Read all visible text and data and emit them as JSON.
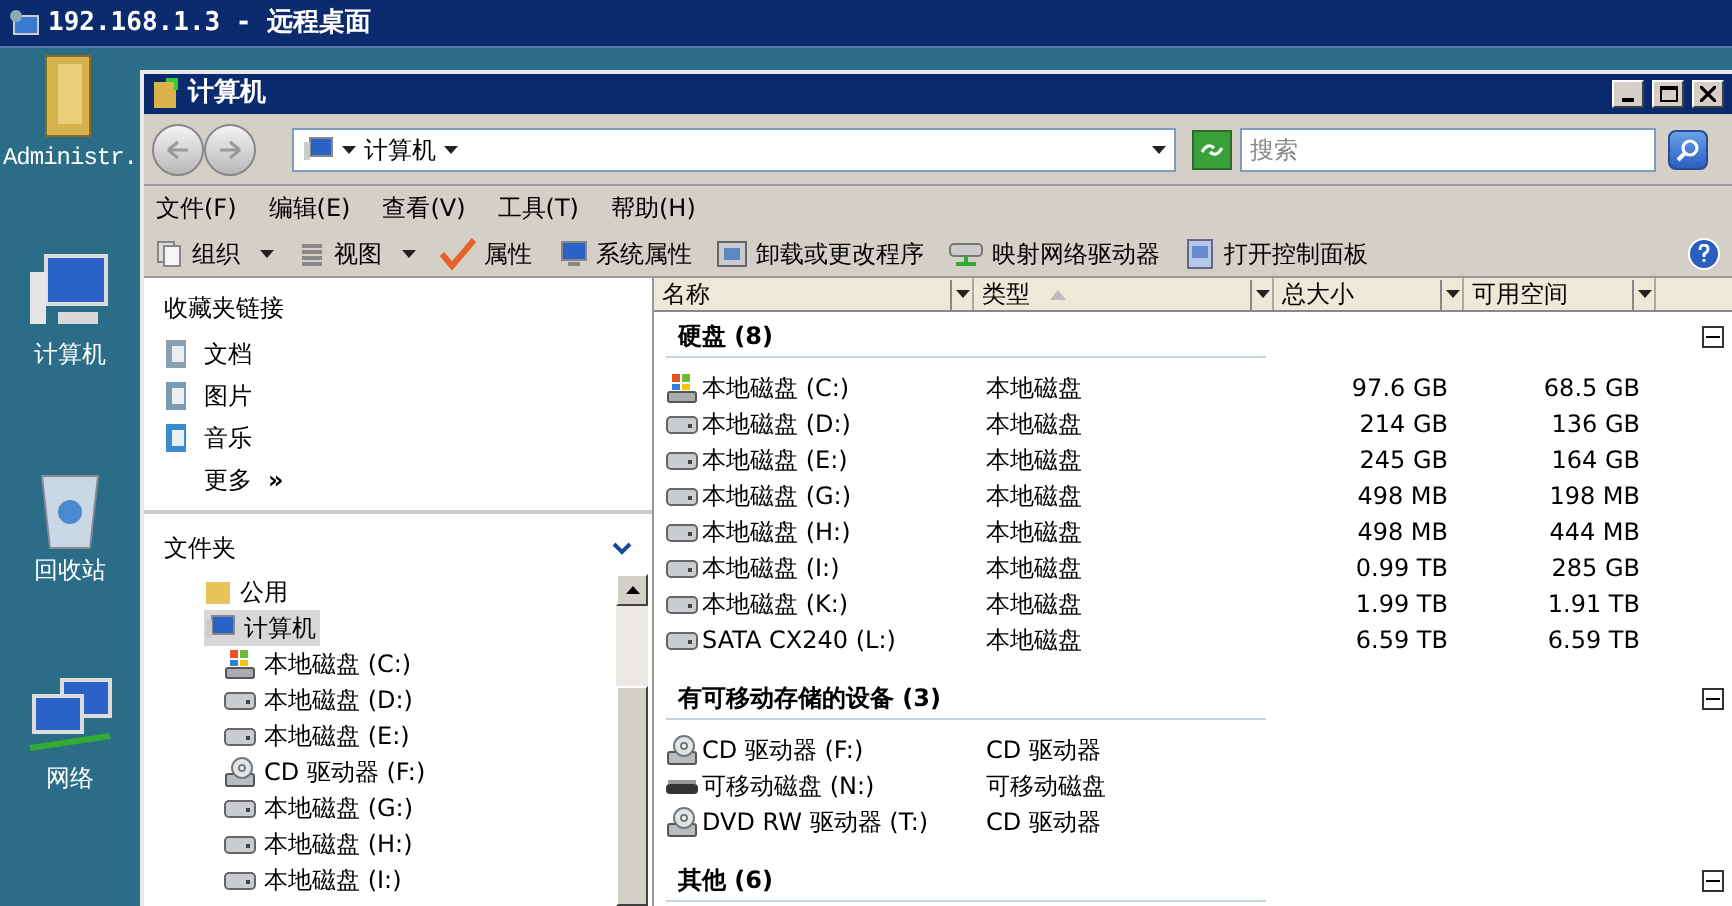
{
  "remote_title": "192.168.1.3 - 远程桌面",
  "desktop_icons": [
    {
      "label": "Administr.",
      "kind": "user"
    },
    {
      "label": "计算机",
      "kind": "computer"
    },
    {
      "label": "回收站",
      "kind": "recycle"
    },
    {
      "label": "网络",
      "kind": "network"
    }
  ],
  "window": {
    "title": "计算机"
  },
  "address": {
    "crumb": "计算机"
  },
  "search": {
    "placeholder": "搜索"
  },
  "menu": [
    "文件(F)",
    "编辑(E)",
    "查看(V)",
    "工具(T)",
    "帮助(H)"
  ],
  "toolbar": [
    {
      "label": "组织",
      "kind": "organize",
      "dropdown": true
    },
    {
      "label": "视图",
      "kind": "views",
      "dropdown": true
    },
    {
      "label": "属性",
      "kind": "properties",
      "dropdown": false
    },
    {
      "label": "系统属性",
      "kind": "system",
      "dropdown": false
    },
    {
      "label": "卸载或更改程序",
      "kind": "uninstall",
      "dropdown": false
    },
    {
      "label": "映射网络驱动器",
      "kind": "mapdrive",
      "dropdown": false
    },
    {
      "label": "打开控制面板",
      "kind": "control",
      "dropdown": false
    }
  ],
  "favorites": {
    "title": "收藏夹链接",
    "items": [
      {
        "label": "文档",
        "kind": "docs"
      },
      {
        "label": "图片",
        "kind": "pics"
      },
      {
        "label": "音乐",
        "kind": "music"
      }
    ],
    "more": "更多",
    "more_glyph": "»"
  },
  "folders": {
    "title": "文件夹",
    "tree": [
      {
        "label": "公用",
        "kind": "folder",
        "selected": false
      },
      {
        "label": "计算机",
        "kind": "computer",
        "selected": true,
        "children": [
          {
            "label": "本地磁盘 (C:)",
            "kind": "system",
            "selected": false
          },
          {
            "label": "本地磁盘 (D:)",
            "kind": "hdd",
            "selected": false
          },
          {
            "label": "本地磁盘 (E:)",
            "kind": "hdd",
            "selected": false
          },
          {
            "label": "CD 驱动器 (F:)",
            "kind": "cd",
            "selected": false
          },
          {
            "label": "本地磁盘 (G:)",
            "kind": "hdd",
            "selected": false
          },
          {
            "label": "本地磁盘 (H:)",
            "kind": "hdd",
            "selected": false
          },
          {
            "label": "本地磁盘 (I:)",
            "kind": "hdd",
            "selected": false
          }
        ]
      }
    ]
  },
  "columns": [
    {
      "label": "名称",
      "sorted": false
    },
    {
      "label": "类型",
      "sorted": true
    },
    {
      "label": "总大小",
      "sorted": false
    },
    {
      "label": "可用空间",
      "sorted": false
    }
  ],
  "groups": [
    {
      "title": "硬盘 (8)",
      "expanded": true,
      "rows": [
        {
          "name": "本地磁盘 (C:)",
          "kind": "system",
          "type": "本地磁盘",
          "size": "97.6 GB",
          "free": "68.5 GB"
        },
        {
          "name": "本地磁盘 (D:)",
          "kind": "hdd",
          "type": "本地磁盘",
          "size": "214 GB",
          "free": "136 GB"
        },
        {
          "name": "本地磁盘 (E:)",
          "kind": "hdd",
          "type": "本地磁盘",
          "size": "245 GB",
          "free": "164 GB"
        },
        {
          "name": "本地磁盘 (G:)",
          "kind": "hdd",
          "type": "本地磁盘",
          "size": "498 MB",
          "free": "198 MB"
        },
        {
          "name": "本地磁盘 (H:)",
          "kind": "hdd",
          "type": "本地磁盘",
          "size": "498 MB",
          "free": "444 MB"
        },
        {
          "name": "本地磁盘 (I:)",
          "kind": "hdd",
          "type": "本地磁盘",
          "size": "0.99 TB",
          "free": "285 GB"
        },
        {
          "name": "本地磁盘 (K:)",
          "kind": "hdd",
          "type": "本地磁盘",
          "size": "1.99 TB",
          "free": "1.91 TB"
        },
        {
          "name": "SATA CX240 (L:)",
          "kind": "hdd",
          "type": "本地磁盘",
          "size": "6.59 TB",
          "free": "6.59 TB"
        }
      ]
    },
    {
      "title": "有可移动存储的设备 (3)",
      "expanded": true,
      "rows": [
        {
          "name": "CD 驱动器 (F:)",
          "kind": "cd",
          "type": "CD 驱动器"
        },
        {
          "name": "可移动磁盘 (N:)",
          "kind": "removable",
          "type": "可移动磁盘"
        },
        {
          "name": "DVD RW 驱动器 (T:)",
          "kind": "cd",
          "type": "CD 驱动器"
        }
      ]
    },
    {
      "title": "其他 (6)",
      "expanded": true
    }
  ]
}
